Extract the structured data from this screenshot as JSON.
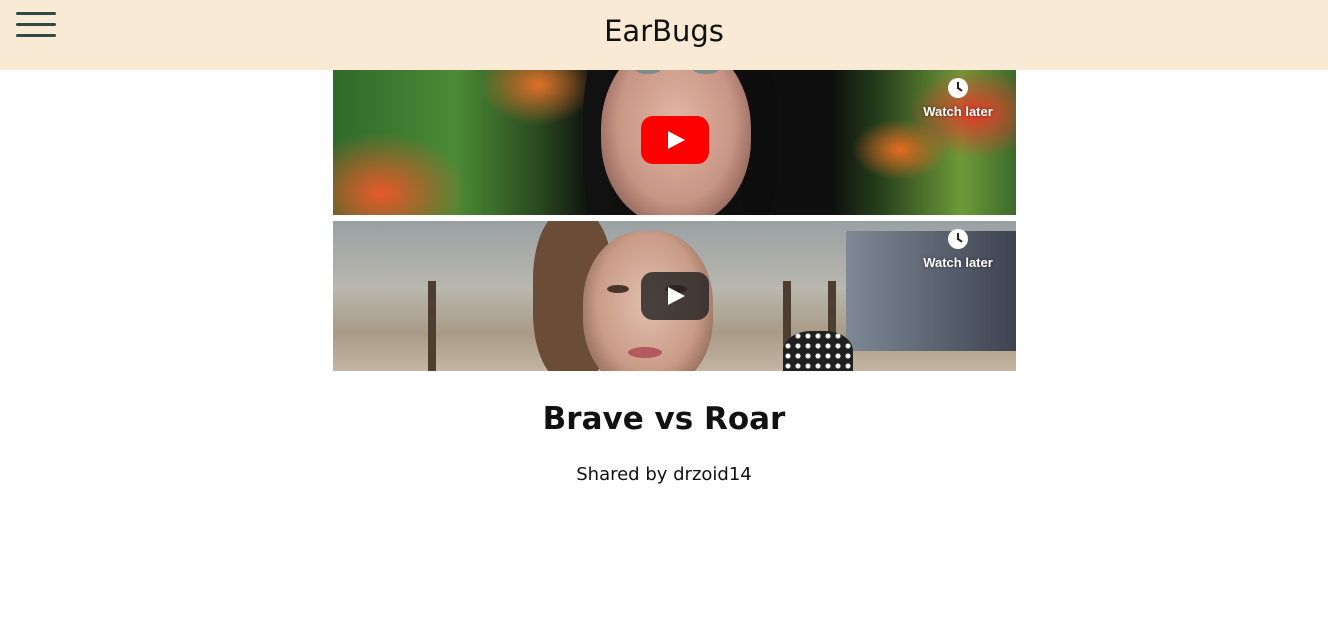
{
  "header": {
    "brand": "EarBugs",
    "menu_icon": "hamburger-menu-icon"
  },
  "videos": [
    {
      "watch_later_label": "Watch later",
      "watch_later_icon": "clock-icon",
      "play_icon": "play-icon",
      "play_color": "#ff0000"
    },
    {
      "watch_later_label": "Watch later",
      "watch_later_icon": "clock-icon",
      "play_icon": "play-icon",
      "play_color": "#212121"
    }
  ],
  "post": {
    "title": "Brave vs Roar",
    "shared_by": "Shared by drzoid14"
  },
  "colors": {
    "header_bg": "#f9ead6",
    "menu_icon": "#2f4a44"
  }
}
